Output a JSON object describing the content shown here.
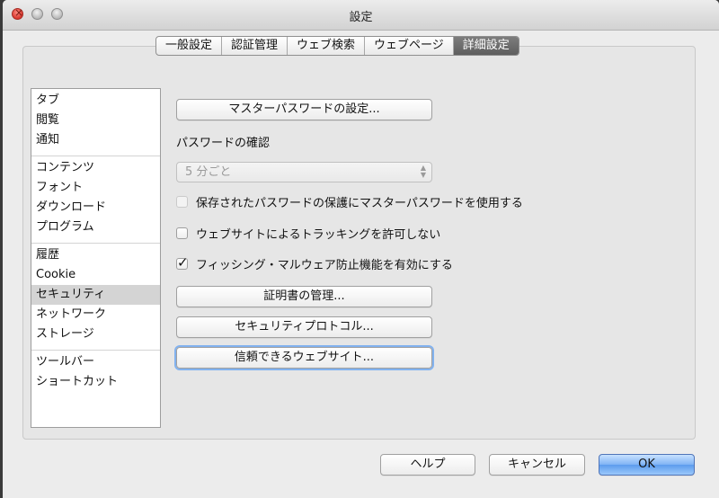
{
  "window": {
    "title": "設定"
  },
  "tabs": [
    {
      "label": "一般設定",
      "active": false
    },
    {
      "label": "認証管理",
      "active": false
    },
    {
      "label": "ウェブ検索",
      "active": false
    },
    {
      "label": "ウェブページ",
      "active": false
    },
    {
      "label": "詳細設定",
      "active": true
    }
  ],
  "sidebar": {
    "groups": [
      [
        {
          "label": "タブ"
        },
        {
          "label": "閲覧"
        },
        {
          "label": "通知"
        }
      ],
      [
        {
          "label": "コンテンツ"
        },
        {
          "label": "フォント"
        },
        {
          "label": "ダウンロード"
        },
        {
          "label": "プログラム"
        }
      ],
      [
        {
          "label": "履歴"
        },
        {
          "label": "Cookie"
        },
        {
          "label": "セキュリティ",
          "selected": true
        },
        {
          "label": "ネットワーク"
        },
        {
          "label": "ストレージ"
        }
      ],
      [
        {
          "label": "ツールバー"
        },
        {
          "label": "ショートカット"
        }
      ]
    ]
  },
  "security": {
    "master_password_button": "マスターパスワードの設定...",
    "password_confirm_label": "パスワードの確認",
    "password_confirm_select": {
      "value": "5 分ごと",
      "disabled": true
    },
    "checkboxes": [
      {
        "label": "保存されたパスワードの保護にマスターパスワードを使用する",
        "checked": false,
        "disabled": true
      },
      {
        "label": "ウェブサイトによるトラッキングを許可しない",
        "checked": false,
        "disabled": false
      },
      {
        "label": "フィッシング・マルウェア防止機能を有効にする",
        "checked": true,
        "disabled": false
      }
    ],
    "certificates_button": "証明書の管理...",
    "protocols_button": "セキュリティプロトコル...",
    "trusted_sites_button": "信頼できるウェブサイト..."
  },
  "footer": {
    "help": "ヘルプ",
    "cancel": "キャンセル",
    "ok": "OK"
  },
  "colors": {
    "selected_tab": "#6a6a6a",
    "default_button": "#7fb3f5",
    "focus_ring": "#82b2ef"
  }
}
